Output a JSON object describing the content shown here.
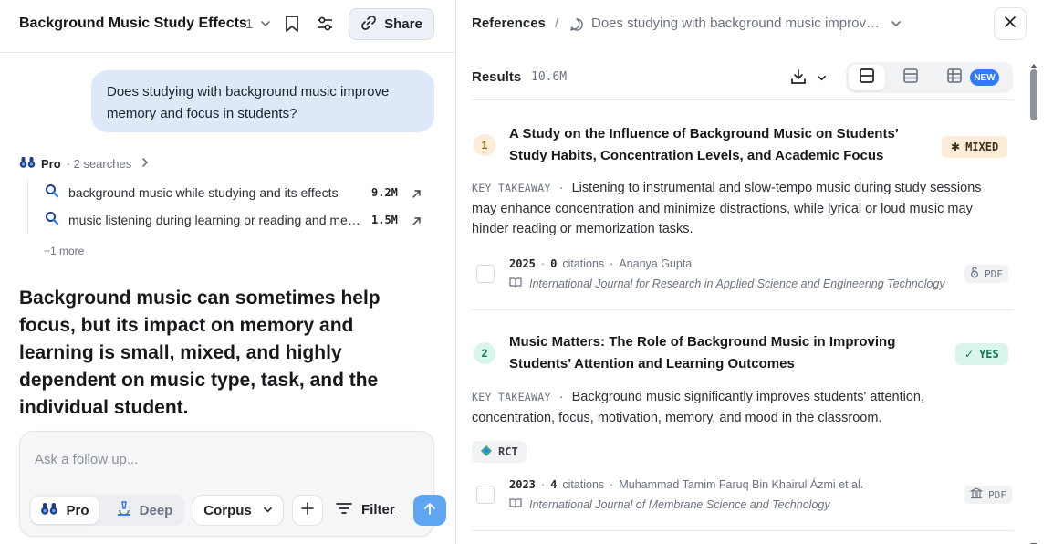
{
  "thread": {
    "title": "Background Music Study Effects",
    "count": "1",
    "share_label": "Share"
  },
  "question": "Does studying with background music improve memory and focus in students?",
  "pro": {
    "label": "Pro",
    "subtitle": "· 2 searches"
  },
  "searches": [
    {
      "text": "background music while studying and its effects",
      "count": "9.2M"
    },
    {
      "text": "music listening during learning or reading and memory",
      "count": "1.5M"
    }
  ],
  "more_label": "+1 more",
  "answer": "Background music can sometimes help focus, but its impact on memory and learning is small, mixed, and highly dependent on music type, task, and the individual student.",
  "composer": {
    "placeholder": "Ask a follow up...",
    "mode_pro": "Pro",
    "mode_deep": "Deep",
    "corpus_label": "Corpus",
    "filter_label": "Filter"
  },
  "references": {
    "title": "References",
    "separator": "/",
    "query": "Does studying with background music improve memory and focus in students?",
    "results_label": "Results",
    "results_count": "10.6M",
    "new_badge": "NEW"
  },
  "papers": [
    {
      "index": "1",
      "title": "A Study on the Influence of Background Music on Students’ Study Habits, Concentration Levels, and Academic Focus",
      "verdict": "MIXED",
      "verdict_symbol": "✱",
      "takeaway_label": "KEY TAKEAWAY",
      "takeaway": "Listening to instrumental and slow-tempo music during study sessions may enhance concentration and minimize distractions, while lyrical or loud music may hinder reading or memorization tasks.",
      "year": "2025",
      "citations": "0",
      "citations_label": "citations",
      "authors": "Ananya Gupta",
      "journal": "International Journal for Research in Applied Science and Engineering Technology",
      "pdf_label": "PDF"
    },
    {
      "index": "2",
      "title": "Music Matters: The Role of Background Music in Improving Students’ Attention and Learning Outcomes",
      "verdict": "YES",
      "verdict_symbol": "✓",
      "takeaway_label": "KEY TAKEAWAY",
      "takeaway": "Background music significantly improves students' attention, concentration, focus, motivation, memory, and mood in the classroom.",
      "study_type": "RCT",
      "year": "2023",
      "citations": "4",
      "citations_label": "citations",
      "authors": "Muhammad Tamim Faruq Bin Khairul Ázmi et al.",
      "journal": "International Journal of Membrane Science and Technology",
      "pdf_label": "PDF"
    }
  ],
  "colors": {
    "bubble": "#dde9f8",
    "accent": "#2f7cf6",
    "send": "#5ea6f2",
    "mixed_bg": "#fdecd6",
    "yes_bg": "#d9f6ea",
    "yes_text": "#117a52"
  }
}
